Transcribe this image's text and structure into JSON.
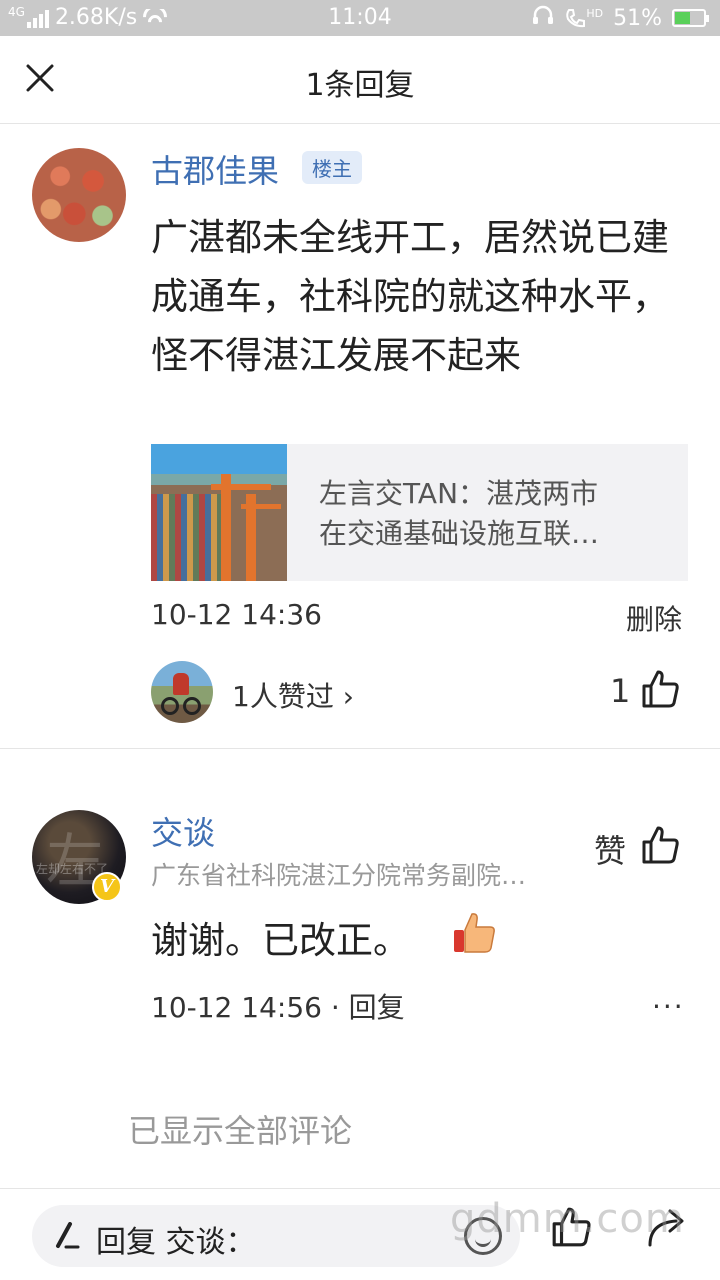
{
  "status_bar": {
    "network": "4G",
    "speed": "2.68K/s",
    "time": "11:04",
    "hd": "HD",
    "battery_percent": "51%",
    "battery_level": 0.51
  },
  "header": {
    "title": "1条回复"
  },
  "main_comment": {
    "author": "古郡佳果",
    "badge": "楼主",
    "text": "广湛都未全线开工，居然说已建成通车，社科院的就这种水平，怪不得湛江发展不起来",
    "link_card": {
      "line1": "左言交TAN：湛茂两市",
      "line2": "在交通基础设施互联…"
    },
    "timestamp": "10-12 14:36",
    "delete_label": "删除",
    "likers_label": "1人赞过 ›",
    "like_count": "1"
  },
  "reply": {
    "author": "交谈",
    "subtitle": "广东省社科院湛江分院常务副院…",
    "like_label": "赞",
    "text": "谢谢。已改正。",
    "timestamp": "10-12 14:56 · 回复",
    "more": "···",
    "avatar_text": "左",
    "avatar_small_text": "左却左右不了",
    "verified_mark": "V"
  },
  "footer_note": "已显示全部评论",
  "bottom_bar": {
    "input_placeholder": "回复 交谈："
  },
  "watermark": "gdmm.com",
  "colors": {
    "link_blue": "#3f6fb3",
    "badge_bg": "#e3ecf9",
    "verified_yellow": "#f5c518",
    "battery_green": "#5ad05a"
  }
}
